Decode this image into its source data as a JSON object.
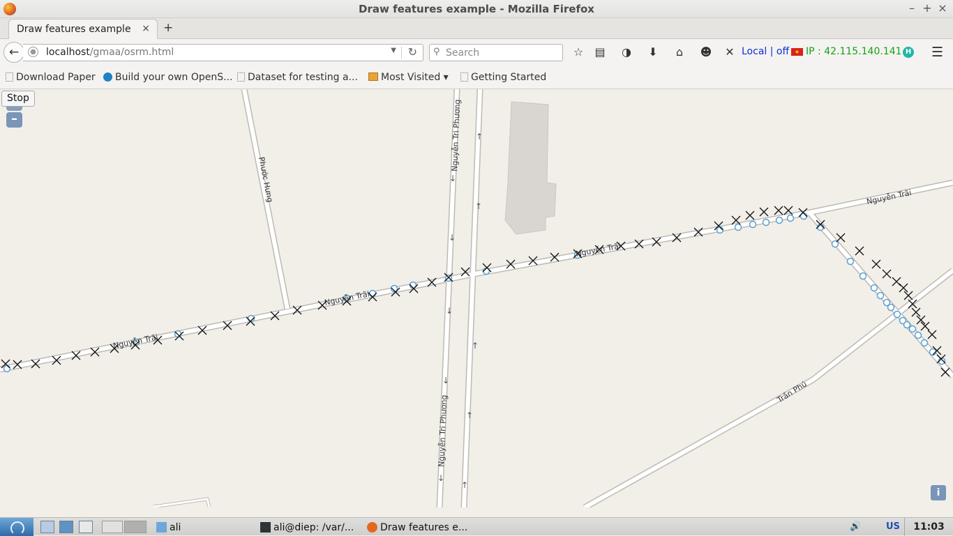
{
  "window": {
    "title": "Draw features example - Mozilla Firefox",
    "controls": [
      "–",
      "+",
      "×"
    ]
  },
  "tabs": [
    {
      "label": "Draw features example",
      "close": "×"
    }
  ],
  "new_tab_label": "+",
  "navbar": {
    "url_host": "localhost",
    "url_path": "/gmaa/osrm.html",
    "search_placeholder": "Search",
    "local_status": "Local | off",
    "ip_text": "IP : 42.115.140.141",
    "badge": "H"
  },
  "bookmarks": [
    {
      "label": "Download Paper",
      "icon": "page-icon"
    },
    {
      "label": "Build your own OpenS...",
      "icon": "drupal-icon"
    },
    {
      "label": "Dataset for testing a...",
      "icon": "page-icon"
    },
    {
      "label": "Most Visited ▾",
      "icon": "folder-icon"
    },
    {
      "label": "Getting Started",
      "icon": "page-icon"
    }
  ],
  "map": {
    "stop_button": "Stop",
    "zoom_out": "–",
    "info": "i",
    "street_labels": {
      "nguyen_trai_1": "Nguyễn Trãi",
      "nguyen_trai_2": "Nguyễn Trãi",
      "nguyen_trai_3": "Nguyễn Trãi",
      "nguyen_trai_4": "Nguyễn Trãi",
      "nguyen_tri_phuong_1": "Nguyễn Tri Phương",
      "nguyen_tri_phuong_2": "Nguyễn Tri Phương",
      "phuoc_hung": "Phước Hưng",
      "tran_phu": "Trần Phú"
    },
    "colors": {
      "map_bg": "#f2efe9",
      "road_casing": "#bdbab4",
      "road_fill": "#ffffff",
      "route_marker": "#5aa0d0",
      "x_marker": "#111111",
      "building": "#d9d6d1"
    }
  },
  "taskbar": {
    "items": [
      {
        "label": "ali",
        "icon": "folder-icon"
      },
      {
        "label": "ali@diep: /var/...",
        "icon": "terminal-icon"
      },
      {
        "label": "Draw features e...",
        "icon": "firefox-icon"
      }
    ],
    "keyboard_layout": "US",
    "clock": "11:03"
  }
}
